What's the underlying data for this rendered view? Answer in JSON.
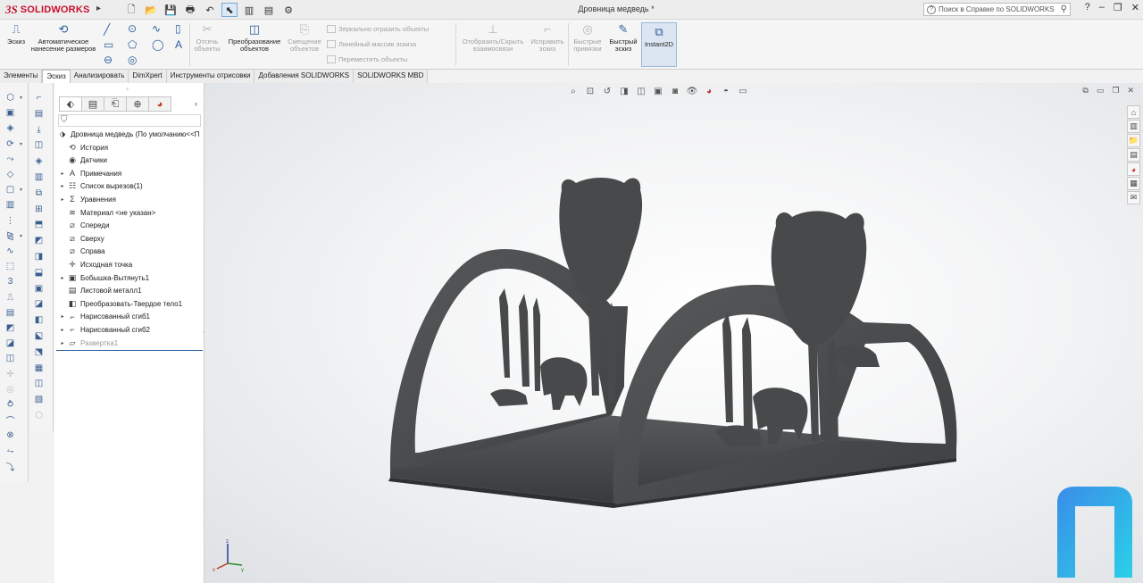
{
  "app": {
    "brand": "SOLIDWORKS",
    "document_title": "Дровница медведь *"
  },
  "help_search": {
    "placeholder": "Поиск в Справке по SOLIDWORKS"
  },
  "ribbon": {
    "sketch": "Эскиз",
    "auto_dim": "Автоматическое нанесение размеров",
    "trim": "Отсечь объекты",
    "convert": "Преобразование объектов",
    "offset": "Смещение объектов",
    "mirror": "Зеркально отразить объекты",
    "linear_pattern": "Линейный массив эскиза",
    "move": "Переместить объекты",
    "show_hide": "Отобразить/Скрыть взаимосвязи",
    "repair": "Исправить эскиз",
    "quick_snaps": "Быстрые привязки",
    "rapid_sketch": "Быстрый эскиз",
    "instant2d": "Instant2D"
  },
  "tabs": [
    {
      "label": "Элементы",
      "active": false
    },
    {
      "label": "Эскиз",
      "active": true
    },
    {
      "label": "Анализировать",
      "active": false
    },
    {
      "label": "DimXpert",
      "active": false
    },
    {
      "label": "Инструменты отрисовки",
      "active": false
    },
    {
      "label": "Добавления SOLIDWORKS",
      "active": false
    },
    {
      "label": "SOLIDWORKS MBD",
      "active": false
    }
  ],
  "tree": {
    "root": "Дровница медведь  (По умолчанию<<П",
    "items": [
      {
        "label": "История",
        "expandable": false,
        "icon": "history-icon"
      },
      {
        "label": "Датчики",
        "expandable": false,
        "icon": "sensor-icon"
      },
      {
        "label": "Примечания",
        "expandable": true,
        "icon": "annotations-icon"
      },
      {
        "label": "Список вырезов(1)",
        "expandable": true,
        "icon": "cutlist-icon"
      },
      {
        "label": "Уравнения",
        "expandable": true,
        "icon": "equations-icon"
      },
      {
        "label": "Материал <не указан>",
        "expandable": false,
        "icon": "material-icon"
      },
      {
        "label": "Спереди",
        "expandable": false,
        "icon": "plane-icon"
      },
      {
        "label": "Сверху",
        "expandable": false,
        "icon": "plane-icon"
      },
      {
        "label": "Справа",
        "expandable": false,
        "icon": "plane-icon"
      },
      {
        "label": "Исходная точка",
        "expandable": false,
        "icon": "origin-icon"
      },
      {
        "label": "Бобышка-Вытянуть1",
        "expandable": true,
        "icon": "extrude-icon"
      },
      {
        "label": "Листовой металл1",
        "expandable": false,
        "icon": "sheetmetal-icon"
      },
      {
        "label": "Преобразовать-Твердое тело1",
        "expandable": false,
        "icon": "convert-icon"
      },
      {
        "label": "Нарисованный сгиб1",
        "expandable": true,
        "icon": "bend-icon"
      },
      {
        "label": "Нарисованный сгиб2",
        "expandable": true,
        "icon": "bend-icon"
      },
      {
        "label": "Развертка1",
        "expandable": true,
        "icon": "flatten-icon",
        "dim": true
      }
    ]
  },
  "colors": {
    "brand": "#c8102e",
    "accent": "#2b5d9c",
    "model": "#4a4c4e"
  }
}
